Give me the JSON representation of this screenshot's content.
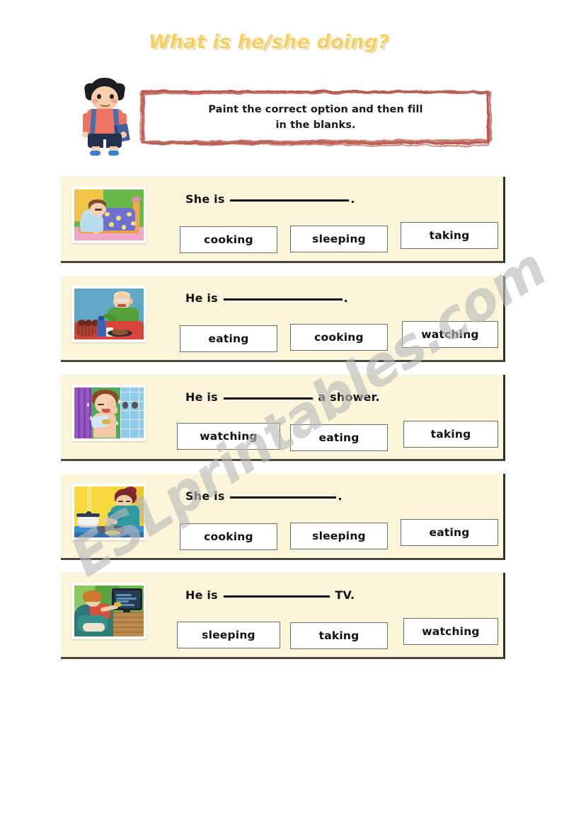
{
  "title": "What is he/she doing?",
  "instruction": {
    "line1": "Paint the correct option and then  fill",
    "line2": "in  the blanks."
  },
  "mascot": {
    "name": "boy-with-backpack"
  },
  "watermark": "ESLprintables.com",
  "colors": {
    "title": "#f5cf63",
    "card_background": "#fcf5d9",
    "instruction_border": "#bf6057",
    "option_border": "#6e6e66",
    "text": "#111111",
    "watermark": "#b9b9b9"
  },
  "exercises": [
    {
      "id": 1,
      "image": "girl-sleeping-in-bed",
      "sentence_prefix": "She is",
      "blank": "______________",
      "sentence_suffix": ".",
      "options": [
        "cooking",
        "sleeping",
        "taking"
      ]
    },
    {
      "id": 2,
      "image": "old-man-eating-at-table",
      "sentence_prefix": "He is",
      "blank": "______________",
      "sentence_suffix": ".",
      "options": [
        "eating",
        "cooking",
        "watching"
      ]
    },
    {
      "id": 3,
      "image": "boy-taking-a-shower",
      "sentence_prefix": "He is",
      "blank": "__________",
      "sentence_suffix": " a shower.",
      "options": [
        "watching",
        "eating",
        "taking"
      ]
    },
    {
      "id": 4,
      "image": "woman-cooking-in-kitchen",
      "sentence_prefix": "She is",
      "blank": "____________",
      "sentence_suffix": ".",
      "options": [
        "cooking",
        "sleeping",
        "eating"
      ]
    },
    {
      "id": 5,
      "image": "boy-watching-tv",
      "sentence_prefix": "He is",
      "blank": "____________",
      "sentence_suffix": " TV.",
      "options": [
        "sleeping",
        "taking",
        "watching"
      ]
    }
  ]
}
